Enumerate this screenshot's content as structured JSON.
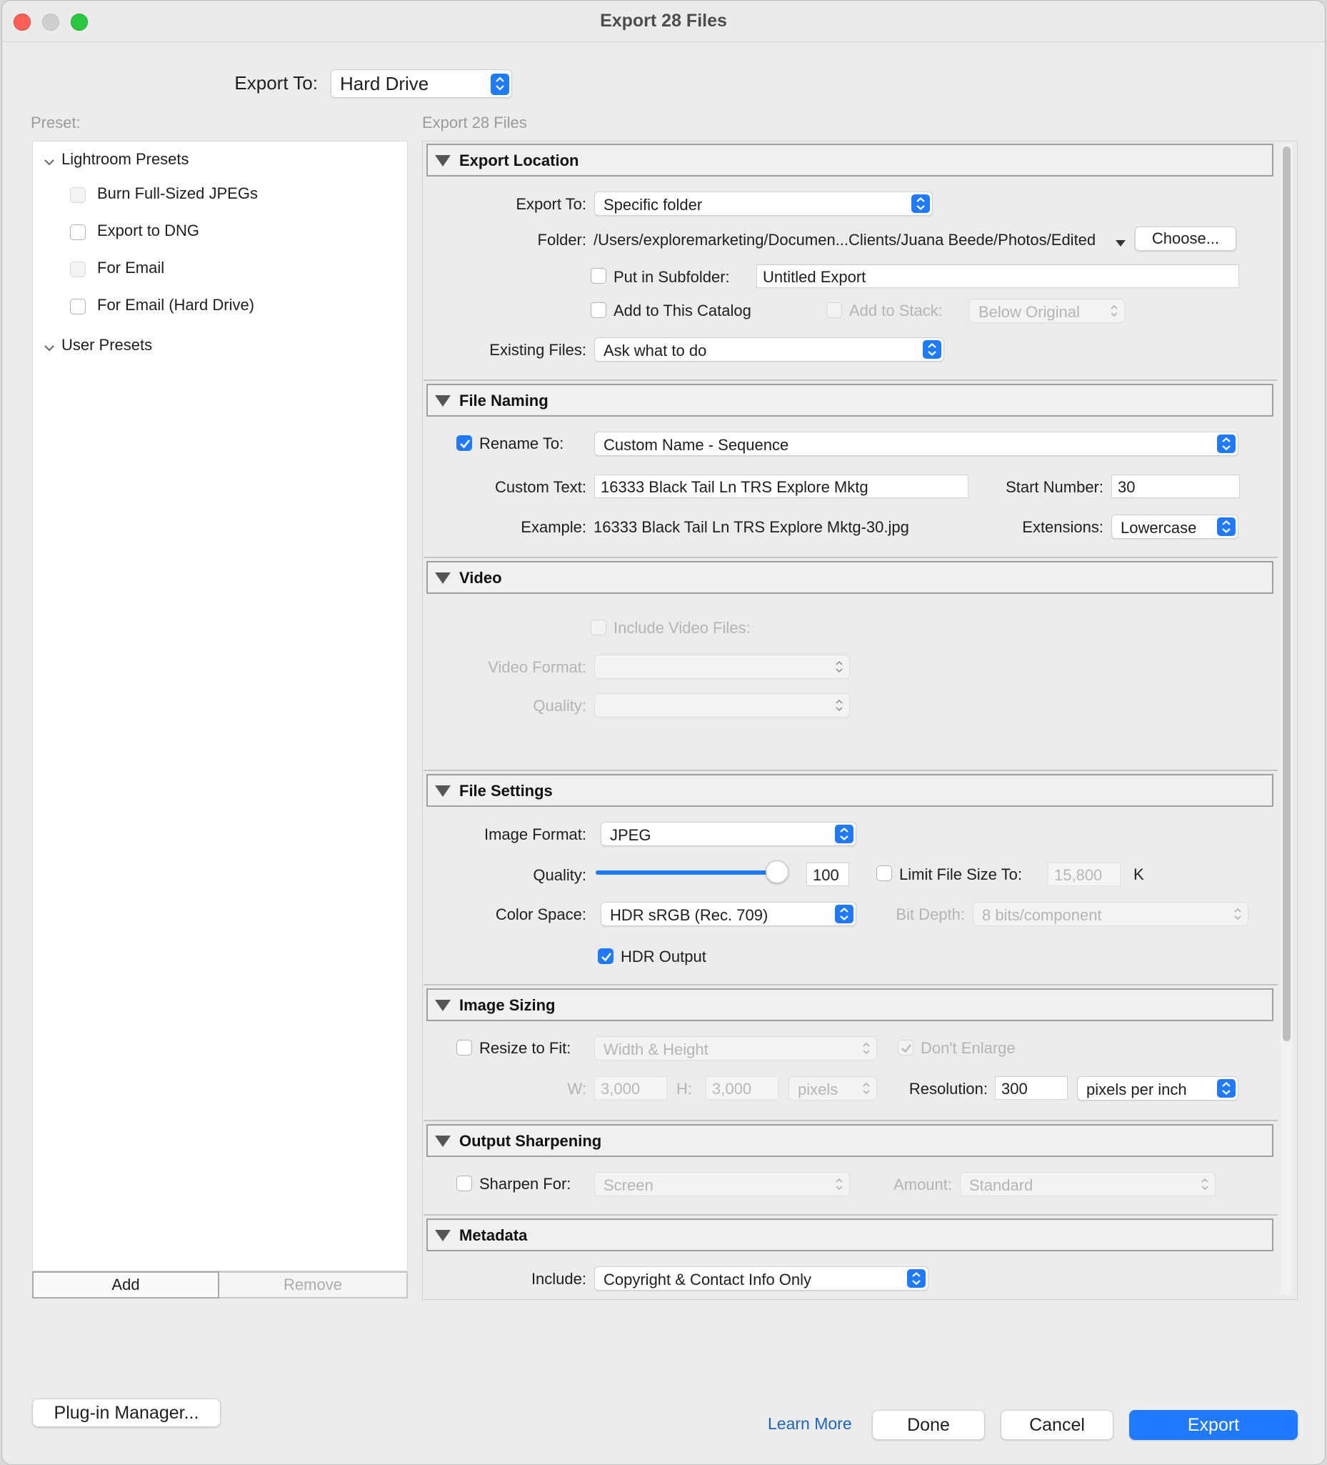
{
  "window": {
    "title": "Export 28 Files"
  },
  "top": {
    "export_to_label": "Export To:",
    "export_to_value": "Hard Drive"
  },
  "presets": {
    "label": "Preset:",
    "groups": [
      {
        "name": "Lightroom Presets",
        "items": [
          "Burn Full-Sized JPEGs",
          "Export to DNG",
          "For Email",
          "For Email (Hard Drive)"
        ]
      },
      {
        "name": "User Presets",
        "items": []
      }
    ],
    "add_label": "Add",
    "remove_label": "Remove"
  },
  "panel_title": "Export 28 Files",
  "export_location": {
    "header": "Export Location",
    "export_to_label": "Export To:",
    "export_to_value": "Specific folder",
    "folder_label": "Folder:",
    "folder_value": "/Users/exploremarketing/Documen...Clients/Juana Beede/Photos/Edited",
    "choose_label": "Choose...",
    "subfolder_label": "Put in Subfolder:",
    "subfolder_value": "Untitled Export",
    "add_catalog_label": "Add to This Catalog",
    "add_stack_label": "Add to Stack:",
    "stack_value": "Below Original",
    "existing_label": "Existing Files:",
    "existing_value": "Ask what to do"
  },
  "file_naming": {
    "header": "File Naming",
    "rename_label": "Rename To:",
    "rename_value": "Custom Name - Sequence",
    "custom_text_label": "Custom Text:",
    "custom_text_value": "16333 Black Tail Ln TRS Explore Mktg",
    "start_number_label": "Start Number:",
    "start_number_value": "30",
    "example_label": "Example:",
    "example_value": "16333 Black Tail Ln TRS Explore Mktg-30.jpg",
    "extensions_label": "Extensions:",
    "extensions_value": "Lowercase"
  },
  "video": {
    "header": "Video",
    "include_label": "Include Video Files:",
    "format_label": "Video Format:",
    "quality_label": "Quality:"
  },
  "file_settings": {
    "header": "File Settings",
    "format_label": "Image Format:",
    "format_value": "JPEG",
    "quality_label": "Quality:",
    "quality_value": "100",
    "quality_level": 100,
    "limit_label": "Limit File Size To:",
    "limit_value": "15,800",
    "limit_unit": "K",
    "color_space_label": "Color Space:",
    "color_space_value": "HDR sRGB (Rec. 709)",
    "bit_depth_label": "Bit Depth:",
    "bit_depth_value": "8 bits/component",
    "hdr_label": "HDR Output"
  },
  "image_sizing": {
    "header": "Image Sizing",
    "resize_label": "Resize to Fit:",
    "resize_value": "Width & Height",
    "dont_enlarge_label": "Don't Enlarge",
    "w_label": "W:",
    "w_value": "3,000",
    "h_label": "H:",
    "h_value": "3,000",
    "units_value": "pixels",
    "resolution_label": "Resolution:",
    "resolution_value": "300",
    "resolution_unit": "pixels per inch"
  },
  "output_sharpening": {
    "header": "Output Sharpening",
    "sharpen_label": "Sharpen For:",
    "sharpen_value": "Screen",
    "amount_label": "Amount:",
    "amount_value": "Standard"
  },
  "metadata": {
    "header": "Metadata",
    "include_label": "Include:",
    "include_value": "Copyright & Contact Info Only"
  },
  "footer": {
    "plugin_label": "Plug-in Manager...",
    "learn_more_label": "Learn More",
    "done_label": "Done",
    "cancel_label": "Cancel",
    "export_label": "Export"
  },
  "colors": {
    "accent": "#1f7aff",
    "link": "#1a64c8"
  }
}
